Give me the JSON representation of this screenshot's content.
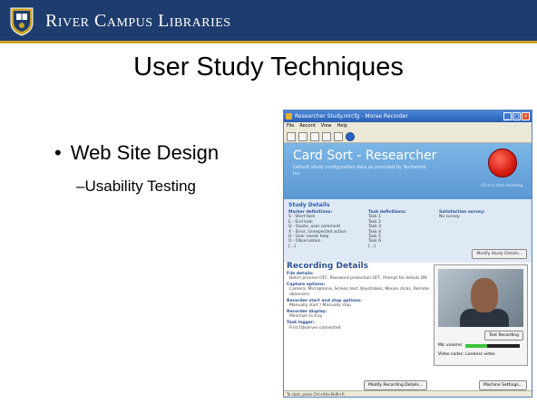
{
  "banner": {
    "brand": "River Campus Libraries",
    "colors": {
      "navy": "#1e3d6e",
      "gold": "#c9a227"
    }
  },
  "slide": {
    "title": "User Study Techniques",
    "bullets": [
      {
        "text": "Web Site Design",
        "sub": "Usability Testing"
      }
    ]
  },
  "app": {
    "window_title": "Researcher Study.mrcfg - Morae Recorder",
    "menu": [
      "File",
      "Record",
      "View",
      "Help"
    ],
    "header_title": "Card Sort - Researcher",
    "header_sub": "Default study configuration data as provided by Techsmith, Inc.",
    "rec_hint": "Click to start recording",
    "study": {
      "title": "Study Details",
      "markers_header": "Marker definitions:",
      "markers": [
        "S - Start task",
        "E - End task",
        "Q - Quote, user comment",
        "X - Error, Unexpected action",
        "H - User needs help",
        "O - Observation",
        "[...]"
      ],
      "tasks_header": "Task definitions:",
      "tasks": [
        "Task 1",
        "Task 2",
        "Task 3",
        "Task 4",
        "Task 5",
        "Task 6",
        "[...]"
      ],
      "survey_header": "Satisfaction survey:",
      "survey_value": "No survey",
      "modify_btn": "Modify Study Details..."
    },
    "recording": {
      "title": "Recording Details",
      "file_h": "File details:",
      "file_v": "Batch process OFF, Password protection OFF, Prompt for details ON",
      "capture_h": "Capture options:",
      "capture_v": "Camera, Microphone, Screen text, Keystrokes, Mouse clicks, Remote observers",
      "startstop_h": "Recorder start and stop options:",
      "startstop_v": "Manually start / Manually stop",
      "display_h": "Recorder display:",
      "display_v": "Minimize to tray",
      "logger_h": "Task logger:",
      "logger_v": "First Observer connected",
      "test_btn": "Test Recording",
      "mic_label": "Mic volume:",
      "mic_level": 0.4,
      "codec": "Video codec: Lossless video",
      "modify_btn": "Modify Recording Details...",
      "machine_btn": "Machine Settings..."
    },
    "status": "To start, press Ctrl+Alt+Shift+R"
  }
}
